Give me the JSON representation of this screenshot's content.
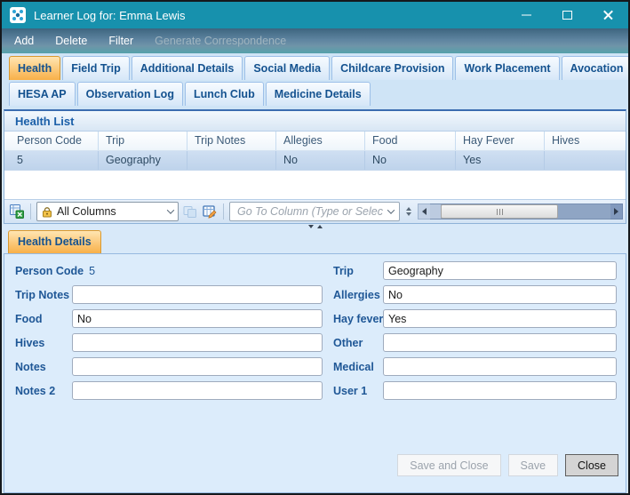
{
  "window": {
    "title": "Learner Log for: Emma Lewis"
  },
  "menu_bar": {
    "items": [
      {
        "label": "Add",
        "enabled": true
      },
      {
        "label": "Delete",
        "enabled": true
      },
      {
        "label": "Filter",
        "enabled": true
      },
      {
        "label": "Generate Correspondence",
        "enabled": false
      }
    ]
  },
  "tab_strip": {
    "active_tab": "Health",
    "row1": [
      "Health",
      "Field Trip",
      "Additional Details",
      "Social Media",
      "Childcare Provision",
      "Work Placement",
      "Avocation"
    ],
    "row2": [
      "HESA AP",
      "Observation Log",
      "Lunch Club",
      "Medicine Details"
    ]
  },
  "health_list": {
    "title": "Health List",
    "columns": [
      "Person Code",
      "Trip",
      "Trip Notes",
      "Allegies",
      "Food",
      "Hay Fever",
      "Hives"
    ],
    "row_cells": [
      "5",
      "Geography",
      "",
      "No",
      "No",
      "Yes",
      ""
    ]
  },
  "grid_toolbar": {
    "column_selector": {
      "value": "All Columns",
      "icon": "lock-icon"
    },
    "goto_column": {
      "placeholder": "Go To Column (Type or Select)",
      "value": ""
    }
  },
  "health_details": {
    "tab_label": "Health Details",
    "fields": {
      "person_code": {
        "label": "Person Code",
        "value": "5"
      },
      "trip": {
        "label": "Trip",
        "value": "Geography"
      },
      "trip_notes": {
        "label": "Trip Notes",
        "value": ""
      },
      "allergies": {
        "label": "Allergies",
        "value": "No"
      },
      "food": {
        "label": "Food",
        "value": "No"
      },
      "hay_fever": {
        "label": "Hay fever",
        "value": "Yes"
      },
      "hives": {
        "label": "Hives",
        "value": ""
      },
      "other": {
        "label": "Other",
        "value": ""
      },
      "notes": {
        "label": "Notes",
        "value": ""
      },
      "medical": {
        "label": "Medical",
        "value": ""
      },
      "notes2": {
        "label": "Notes 2",
        "value": ""
      },
      "user1": {
        "label": "User 1",
        "value": ""
      }
    }
  },
  "footer": {
    "buttons": [
      {
        "label": "Save and Close",
        "enabled": false
      },
      {
        "label": "Save",
        "enabled": false
      },
      {
        "label": "Close",
        "enabled": true
      }
    ]
  },
  "colors": {
    "titlebar": "#1791ad",
    "active_tab": "#f8b049",
    "tab_text": "#14528f",
    "selection_row": "#c6d9ee",
    "form_background": "#dcecfb"
  }
}
